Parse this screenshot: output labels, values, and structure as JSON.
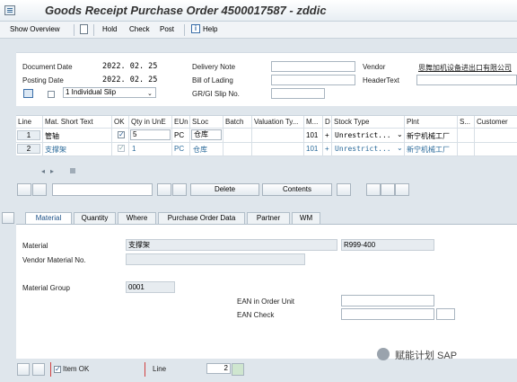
{
  "window": {
    "title": "Goods Receipt Purchase Order 4500017587 - zddic"
  },
  "toolbar": {
    "show_overview": "Show Overview",
    "hold": "Hold",
    "check": "Check",
    "post": "Post",
    "help": "Help"
  },
  "header": {
    "document_date_label": "Document Date",
    "document_date": "2022. 02. 25",
    "posting_date_label": "Posting Date",
    "posting_date": "2022. 02. 25",
    "slip_select": "1 Individual Slip",
    "delivery_note_label": "Delivery Note",
    "delivery_note": "",
    "bill_of_lading_label": "Bill of Lading",
    "bill_of_lading": "",
    "gr_gi_slip_label": "GR/GI Slip No.",
    "gr_gi_slip": "",
    "vendor_label": "Vendor",
    "vendor": "思舞加机设备进出口有限公司",
    "header_text_label": "HeaderText",
    "header_text": ""
  },
  "grid": {
    "columns": [
      "Line",
      "Mat. Short Text",
      "OK",
      "Qty in UnE",
      "EUn",
      "SLoc",
      "Batch",
      "Valuation Ty...",
      "M...",
      "D",
      "Stock Type",
      "Plnt",
      "S...",
      "Customer"
    ],
    "rows": [
      {
        "line": "1",
        "text": "管轴",
        "ok": "✓",
        "qty": "5",
        "eun": "PC",
        "sloc": "仓库",
        "batch": "",
        "val": "",
        "mvt": "101",
        "d": "+",
        "stock": "Unrestrict...",
        "plant": "新宁机械工厂"
      },
      {
        "line": "2",
        "text": "支撑架",
        "ok": "✓",
        "qty": "1",
        "eun": "PC",
        "sloc": "仓库",
        "batch": "",
        "val": "",
        "mvt": "101",
        "d": "+",
        "stock": "Unrestrict...",
        "plant": "新宁机械工厂"
      }
    ]
  },
  "actions": {
    "delete": "Delete",
    "contents": "Contents"
  },
  "tabs": [
    "Material",
    "Quantity",
    "Where",
    "Purchase Order Data",
    "Partner",
    "WM"
  ],
  "detail": {
    "material_label": "Material",
    "material_text": "支撑架",
    "material_no": "R999-400",
    "vendor_material_label": "Vendor Material No.",
    "vendor_material": "",
    "material_group_label": "Material Group",
    "material_group": "0001",
    "ean_order_unit_label": "EAN in Order Unit",
    "ean_order_unit": "",
    "ean_check_label": "EAN Check",
    "ean_check": ""
  },
  "footer": {
    "item_ok_label": "Item OK",
    "line_label": "Line",
    "line_value": "2"
  },
  "watermark": "赋能计划 SAP"
}
